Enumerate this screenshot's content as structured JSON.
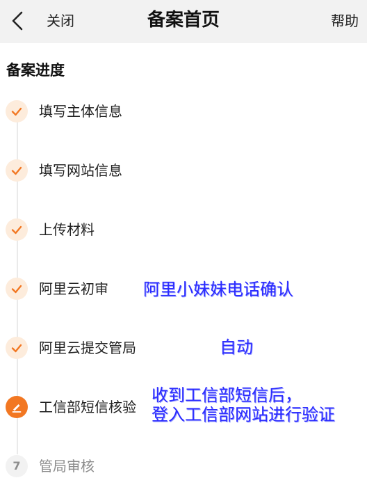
{
  "header": {
    "close_label": "关闭",
    "title": "备案首页",
    "help_label": "帮助"
  },
  "section_title": "备案进度",
  "steps": [
    {
      "label": "填写主体信息",
      "status": "done"
    },
    {
      "label": "填写网站信息",
      "status": "done"
    },
    {
      "label": "上传材料",
      "status": "done"
    },
    {
      "label": "阿里云初审",
      "status": "done"
    },
    {
      "label": "阿里云提交管局",
      "status": "done"
    },
    {
      "label": "工信部短信核验",
      "status": "active"
    },
    {
      "label": "管局审核",
      "status": "pending",
      "number": "7"
    }
  ],
  "annotations": {
    "first_review": "阿里小妹妹电话确认",
    "submit_bureau": "自动",
    "sms_verify_line1": "收到工信部短信后，",
    "sms_verify_line2": "登入工信部网站进行验证"
  },
  "colors": {
    "accent": "#f27722",
    "done_circle": "#fdecdc",
    "annotation": "#2b2bff",
    "header_bg": "#f2f2f2"
  },
  "icons": {
    "back": "chevron-left-icon",
    "done": "check-icon",
    "active": "pencil-icon"
  }
}
